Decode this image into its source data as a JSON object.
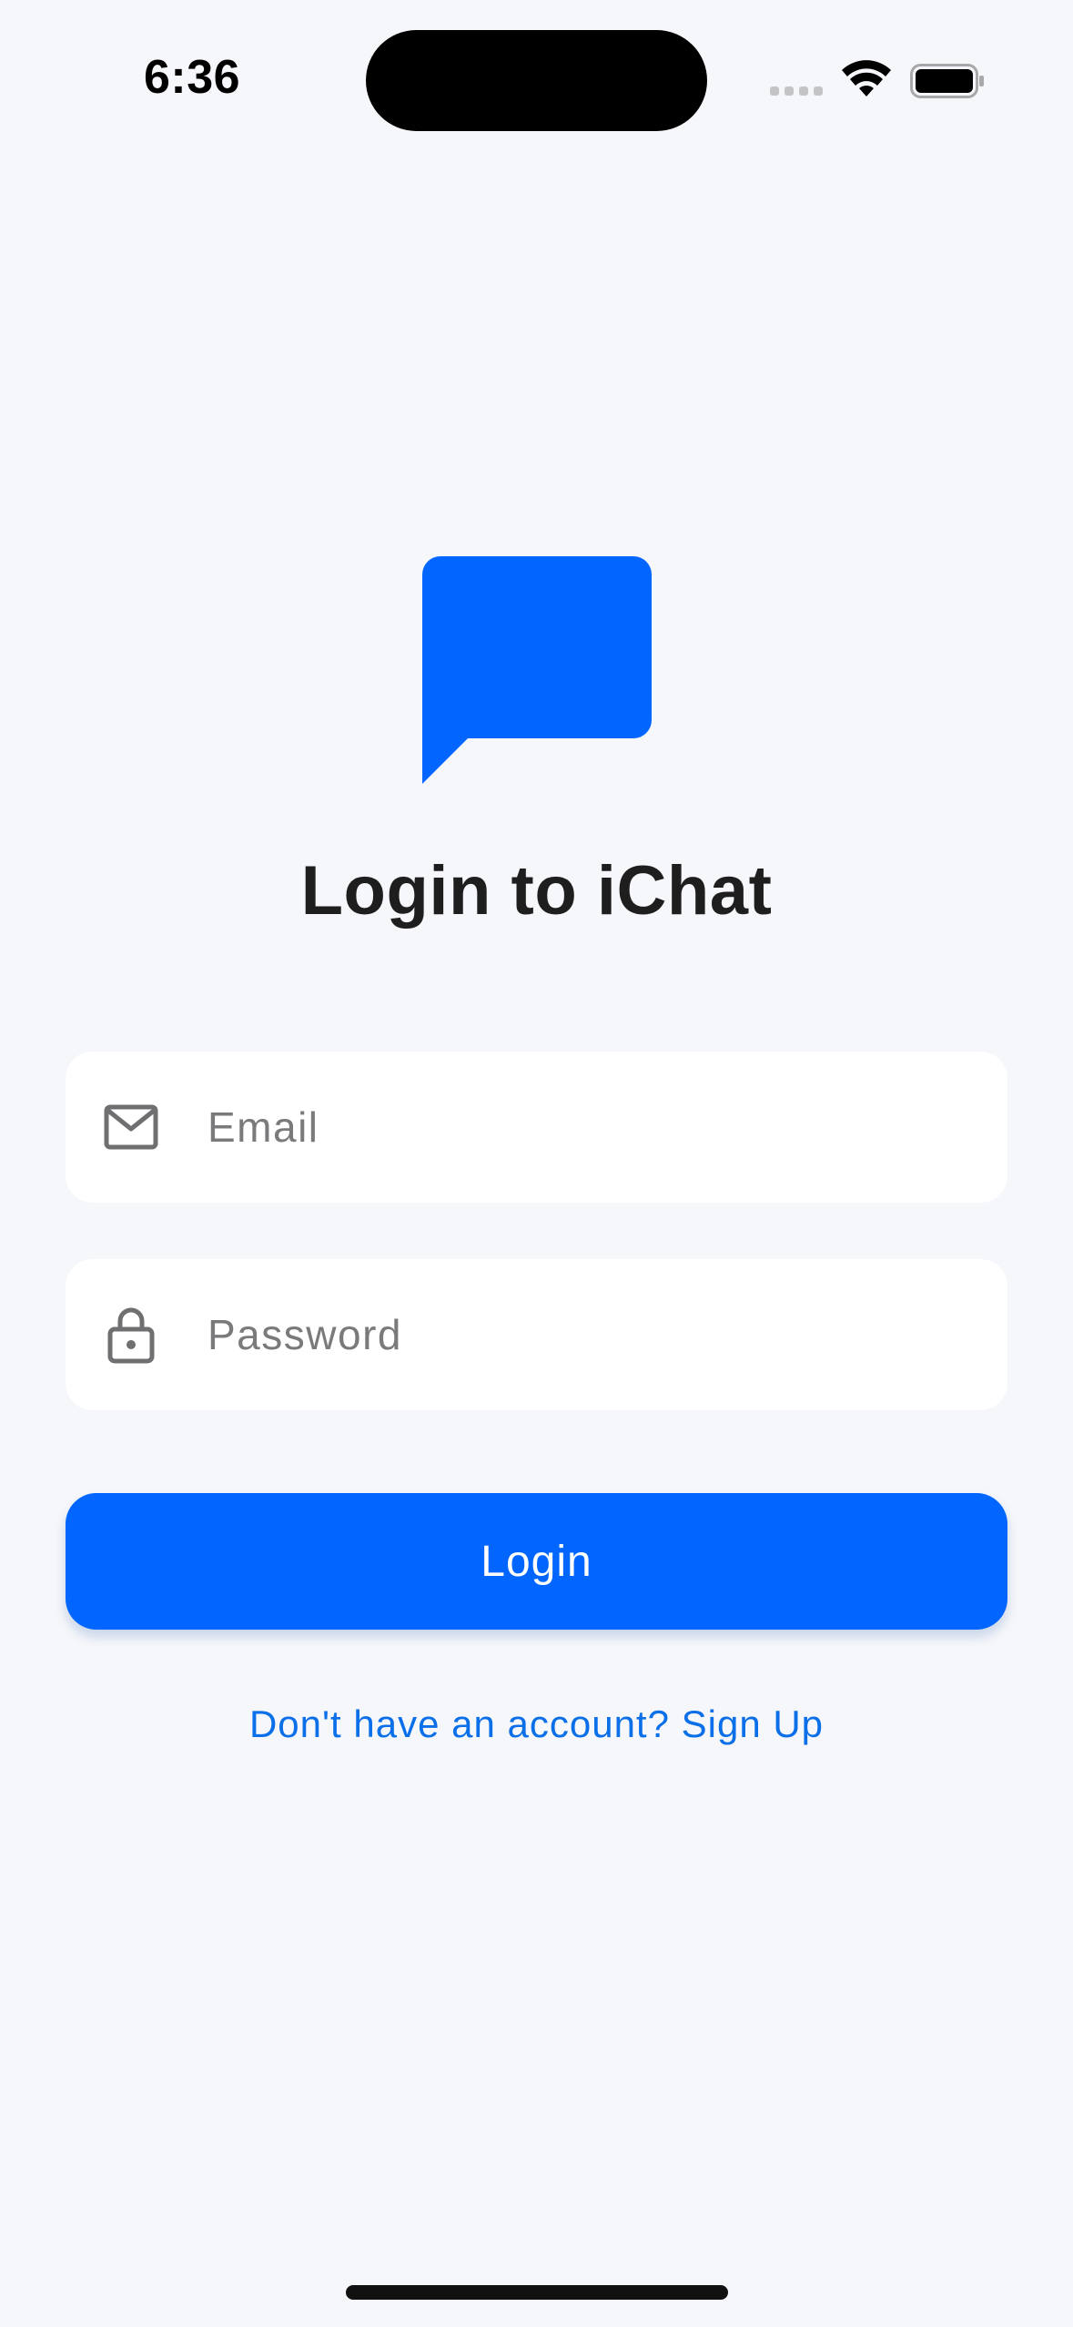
{
  "status_bar": {
    "time": "6:36"
  },
  "app": {
    "name": "iChat",
    "brand_color": "#0066FF",
    "logo_icon": "chat-bubble-icon"
  },
  "login": {
    "title": "Login to iChat",
    "email_field": {
      "placeholder": "Email",
      "value": "",
      "icon": "envelope-icon"
    },
    "password_field": {
      "placeholder": "Password",
      "value": "",
      "icon": "lock-icon"
    },
    "login_button_label": "Login",
    "signup_link": "Don't have an account? Sign Up"
  }
}
